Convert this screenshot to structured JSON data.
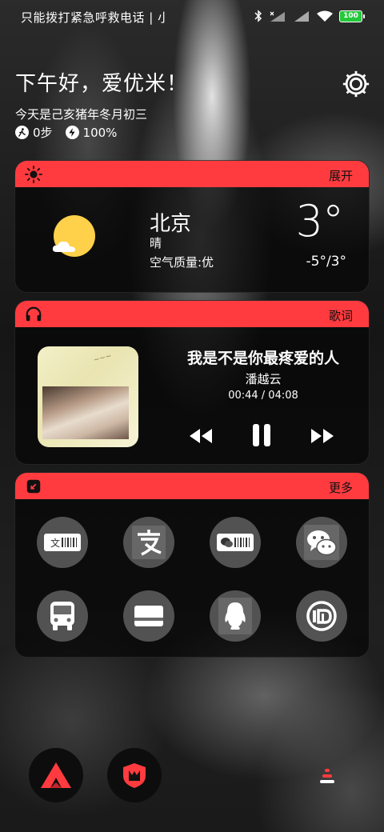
{
  "status_bar": {
    "carrier_text": "只能拨打紧急呼救电话 | 小",
    "battery": "100",
    "icons": [
      "bluetooth-icon",
      "signal-x-icon",
      "signal-icon",
      "wifi-icon",
      "battery-icon"
    ]
  },
  "header": {
    "greeting": "下午好，爱优米！",
    "lunar_date": "今天是己亥猪年冬月初三",
    "steps": "0步",
    "battery_level": "100%"
  },
  "weather": {
    "action": "展开",
    "city": "北京",
    "condition": "晴",
    "air_quality": "空气质量:优",
    "temperature": "3°",
    "range": "-5°/3°"
  },
  "music": {
    "action": "歌词",
    "title": "我是不是你最疼爱的人",
    "artist": "潘越云",
    "time": "00:44 / 04:08"
  },
  "shortcuts": {
    "action": "更多",
    "items": [
      {
        "name": "alipay-pay-code-icon"
      },
      {
        "name": "alipay-icon"
      },
      {
        "name": "wechat-pay-code-icon"
      },
      {
        "name": "wechat-icon"
      },
      {
        "name": "bus-icon"
      },
      {
        "name": "card-icon"
      },
      {
        "name": "qq-icon"
      },
      {
        "name": "mi-home-icon"
      }
    ]
  },
  "colors": {
    "accent": "#ff3b3f",
    "card_bg": "#0a0a0a",
    "sun": "#ffd04a",
    "battery_green": "#22c93a"
  }
}
